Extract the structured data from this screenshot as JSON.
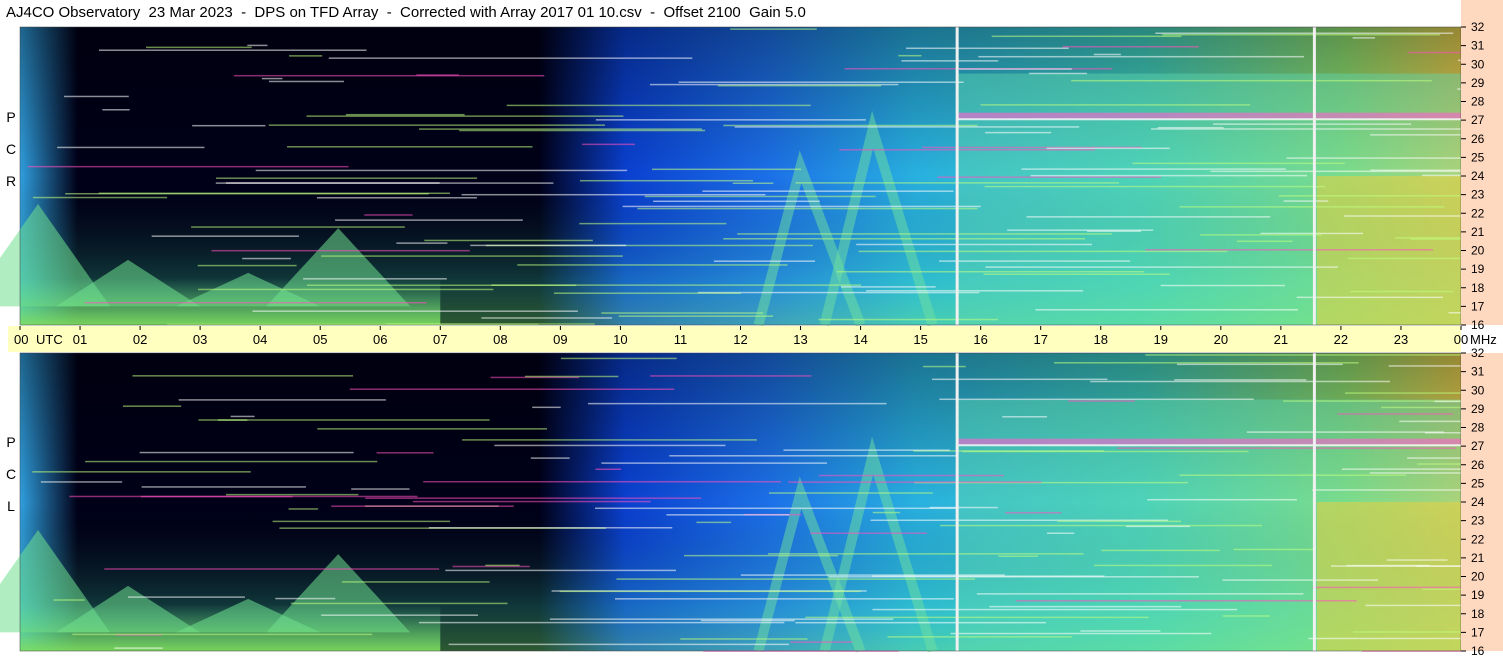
{
  "header": {
    "title": "AJ4CO Observatory  23 Mar 2023  -  DPS on TFD Array  -  Corrected with Array 2017 01 10.csv  -  Offset 2100  Gain 5.0"
  },
  "panels": {
    "top": {
      "polarization": [
        "R",
        "C",
        "P"
      ]
    },
    "bottom": {
      "polarization": [
        "L",
        "C",
        "P"
      ]
    }
  },
  "colors": {
    "background": "#ffffff",
    "time_bar": "#ffffc0",
    "freq_scale": "#ffd8c0",
    "spectrogram_low": "#000010",
    "spectrogram_mid": "#1060ff",
    "spectrogram_high": "#e0e040",
    "spectrogram_peak": "#ff40c0"
  },
  "chart_data": {
    "type": "heatmap",
    "title": "AJ4CO Observatory  23 Mar 2023  -  DPS on TFD Array  -  Corrected with Array 2017 01 10.csv  -  Offset 2100  Gain 5.0",
    "x_axis": {
      "unit": "UTC",
      "tick_labels": [
        "00",
        "01",
        "02",
        "03",
        "04",
        "05",
        "06",
        "07",
        "08",
        "09",
        "10",
        "11",
        "12",
        "13",
        "14",
        "15",
        "16",
        "17",
        "18",
        "19",
        "20",
        "21",
        "22",
        "23",
        "00"
      ],
      "range": [
        0,
        24
      ]
    },
    "y_axis": {
      "unit": "MHz",
      "tick_labels": [
        "32",
        "31",
        "30",
        "29",
        "28",
        "27",
        "26",
        "25",
        "24",
        "23",
        "22",
        "21",
        "20",
        "19",
        "18",
        "17",
        "16"
      ],
      "range": [
        16,
        32
      ]
    },
    "series": [
      {
        "name": "RCP",
        "panel": "top"
      },
      {
        "name": "LCP",
        "panel": "bottom"
      }
    ],
    "markers": {
      "vertical_lines_utc": [
        15.6,
        21.55
      ]
    }
  }
}
